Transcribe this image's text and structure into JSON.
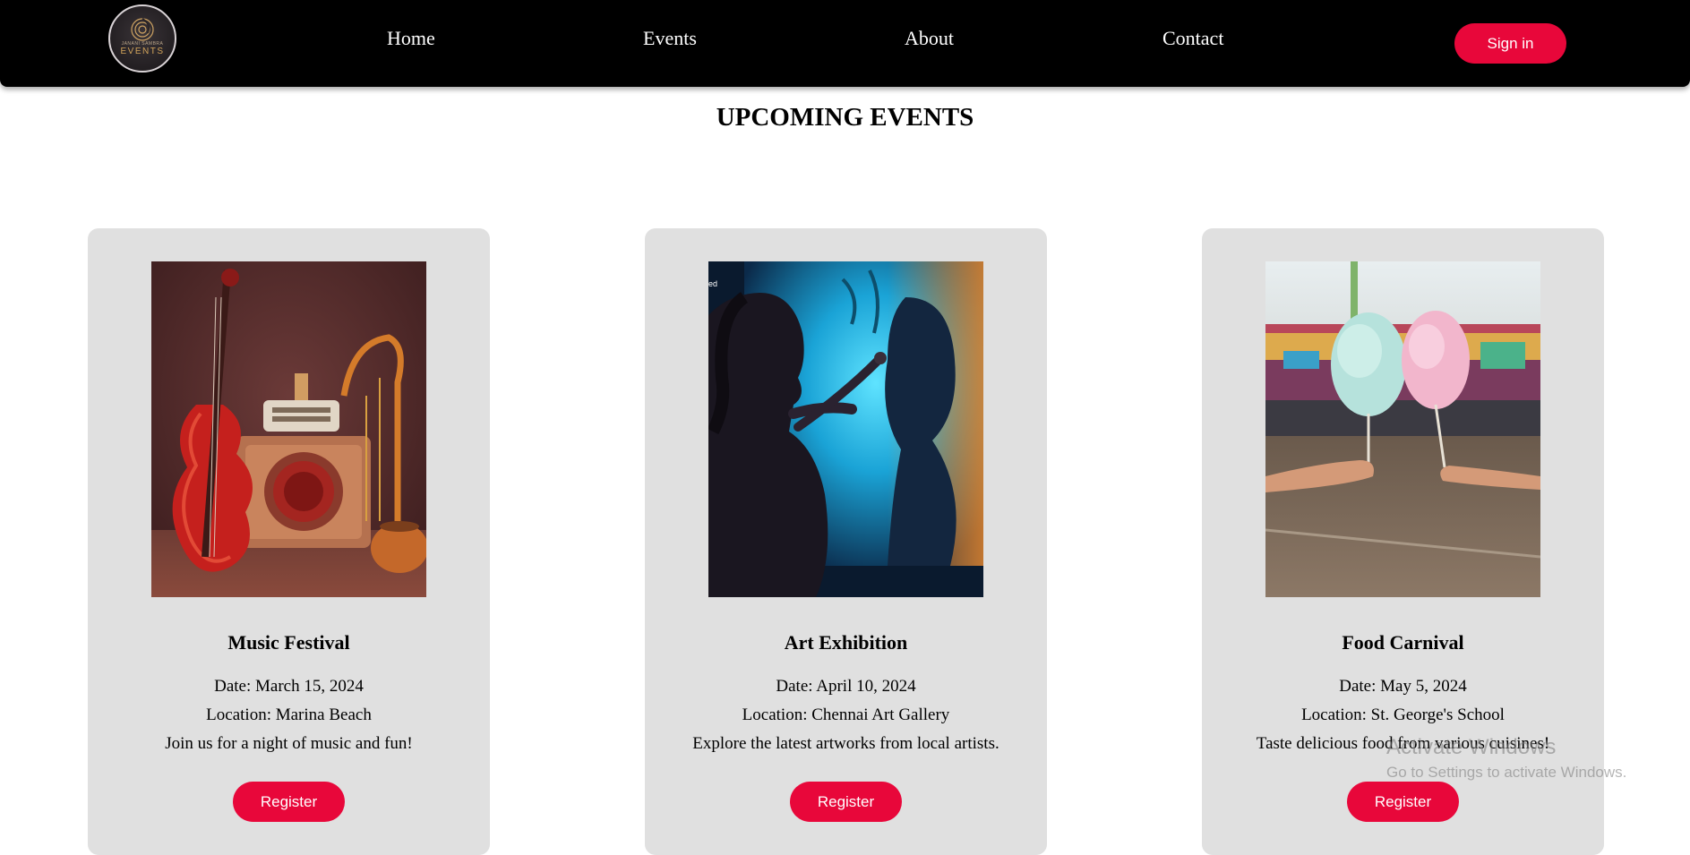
{
  "header": {
    "logo_small": "JANANI SAMBRA",
    "logo_text": "EVENTS",
    "nav": [
      "Home",
      "Events",
      "About",
      "Contact"
    ],
    "signin_label": "Sign in",
    "accent_color": "#e8073a"
  },
  "main": {
    "title": "UPCOMING EVENTS",
    "events": [
      {
        "title": "Music Festival",
        "date": "Date: March 15, 2024",
        "location": "Location: Marina Beach",
        "description": "Join us for a night of music and fun!",
        "register_label": "Register",
        "image": "music-instruments-illustration"
      },
      {
        "title": "Art Exhibition",
        "date": "Date: April 10, 2024",
        "location": "Location: Chennai Art Gallery",
        "description": "Explore the latest artworks from local artists.",
        "register_label": "Register",
        "image": "girl-painting-illustration"
      },
      {
        "title": "Food Carnival",
        "date": "Date: May 5, 2024",
        "location": "Location: St. George's School",
        "description": "Taste delicious food from various cuisines!",
        "register_label": "Register",
        "image": "cotton-candy-carnival-photo"
      }
    ]
  },
  "watermark": {
    "line1": "Activate Windows",
    "line2": "Go to Settings to activate Windows."
  }
}
